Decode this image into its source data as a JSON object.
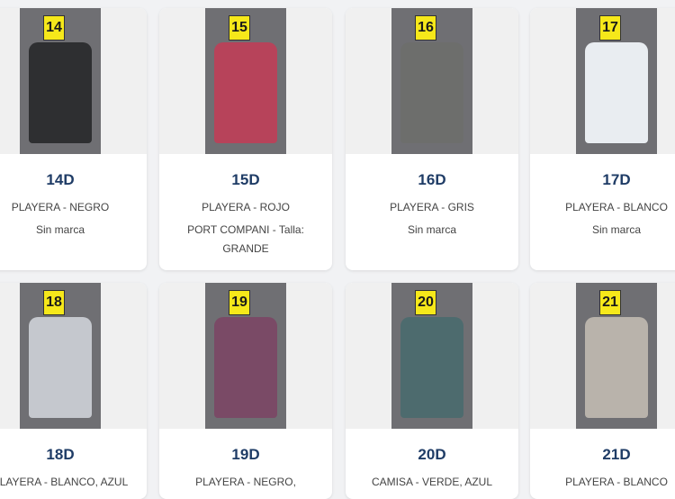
{
  "items": [
    {
      "code": "14D",
      "description": "PLAYERA - NEGRO",
      "brand": "Sin marca",
      "marker": "14",
      "garment_color": "#2e2f31"
    },
    {
      "code": "15D",
      "description": "PLAYERA - ROJO",
      "brand": "PORT COMPANI - Talla: GRANDE",
      "marker": "15",
      "garment_color": "#b7435a"
    },
    {
      "code": "16D",
      "description": "PLAYERA - GRIS",
      "brand": "Sin marca",
      "marker": "16",
      "garment_color": "#6d6e6c"
    },
    {
      "code": "17D",
      "description": "PLAYERA - BLANCO",
      "brand": "Sin marca",
      "marker": "17",
      "garment_color": "#e9edf1"
    },
    {
      "code": "18D",
      "description": "PLAYERA - BLANCO, AZUL",
      "brand": "",
      "marker": "18",
      "garment_color": "#c5c8ce"
    },
    {
      "code": "19D",
      "description": "PLAYERA - NEGRO,",
      "brand": "",
      "marker": "19",
      "garment_color": "#7a4a66"
    },
    {
      "code": "20D",
      "description": "CAMISA - VERDE, AZUL",
      "brand": "",
      "marker": "20",
      "garment_color": "#4d6b6e"
    },
    {
      "code": "21D",
      "description": "PLAYERA - BLANCO",
      "brand": "",
      "marker": "21",
      "garment_color": "#b9b3ab"
    }
  ]
}
